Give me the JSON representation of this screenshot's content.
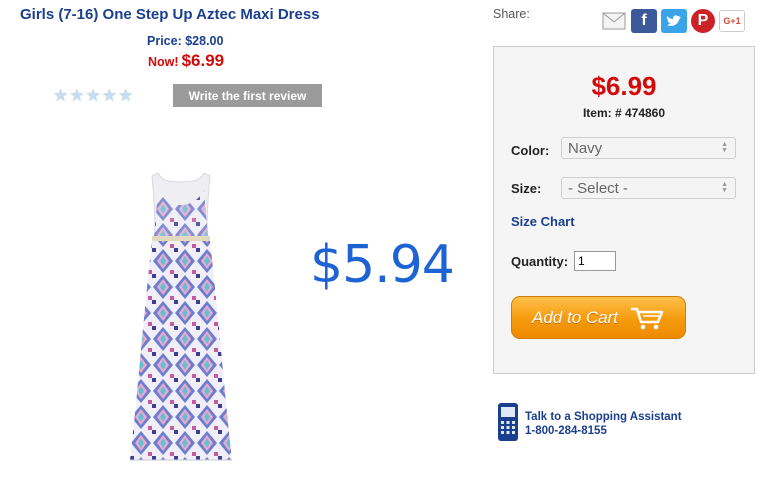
{
  "product": {
    "title": "Girls (7-16) One Step Up Aztec Maxi Dress",
    "price_label": "Price: $28.00",
    "now_label": "Now!",
    "now_price": "$6.99",
    "rating_stars": 5,
    "rating_value": 0,
    "review_button": "Write the first review",
    "overlay_price": "$5.94"
  },
  "share": {
    "label": "Share:",
    "icons": [
      "mail-icon",
      "facebook-icon",
      "twitter-icon",
      "pinterest-icon",
      "google-plus-icon"
    ],
    "gplus_text": "G+1"
  },
  "buybox": {
    "price": "$6.99",
    "item_number": "Item: # 474860",
    "color_label": "Color:",
    "color_value": "Navy",
    "size_label": "Size:",
    "size_value": "- Select -",
    "size_chart": "Size Chart",
    "quantity_label": "Quantity:",
    "quantity_value": "1",
    "add_to_cart": "Add to Cart"
  },
  "assistant": {
    "line1": "Talk to a Shopping Assistant",
    "phone": "1-800-284-8155"
  },
  "colors": {
    "title_blue": "#1a3f8f",
    "sale_red": "#d40a0a",
    "overlay_blue": "#1e63d4",
    "cart_orange": "#f59a0c"
  }
}
